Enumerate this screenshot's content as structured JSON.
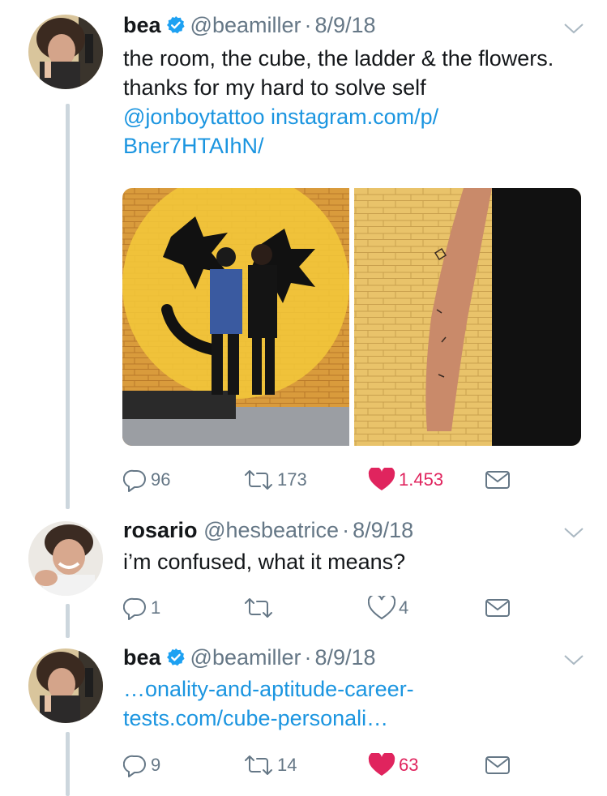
{
  "tweets": [
    {
      "name": "bea",
      "verified": true,
      "handle": "@beamiller",
      "date": "8/9/18",
      "text": "the room, the cube, the ladder & the flowers. thanks for my hard to solve self",
      "link1": "@jonboytattoo",
      "link2": "instagram.com/p/",
      "link3": "Bner7HTAIhN/",
      "replies": "96",
      "retweets": "173",
      "likes": "1.453",
      "liked": true
    },
    {
      "name": "rosario",
      "verified": false,
      "handle": "@hesbeatrice",
      "date": "8/9/18",
      "text": "i’m confused, what it means?",
      "replies": "1",
      "retweets": "",
      "likes": "4",
      "liked": false
    },
    {
      "name": "bea",
      "verified": true,
      "handle": "@beamiller",
      "date": "8/9/18",
      "link1": "…onality-and-aptitude-career-",
      "link2": "tests.com/cube-personali…",
      "replies": "9",
      "retweets": "14",
      "likes": "63",
      "liked": true
    }
  ],
  "dot": "·",
  "icons": {
    "reply": "reply-icon",
    "retweet": "retweet-icon",
    "like": "heart-icon",
    "dm": "envelope-icon",
    "verified": "verified-badge-icon",
    "caret": "chevron-down-icon"
  },
  "colors": {
    "link": "#1b95e0",
    "like": "#e0245e",
    "muted": "#657786",
    "thread_line": "#ccd6dd",
    "verified": "#1da1f2"
  }
}
